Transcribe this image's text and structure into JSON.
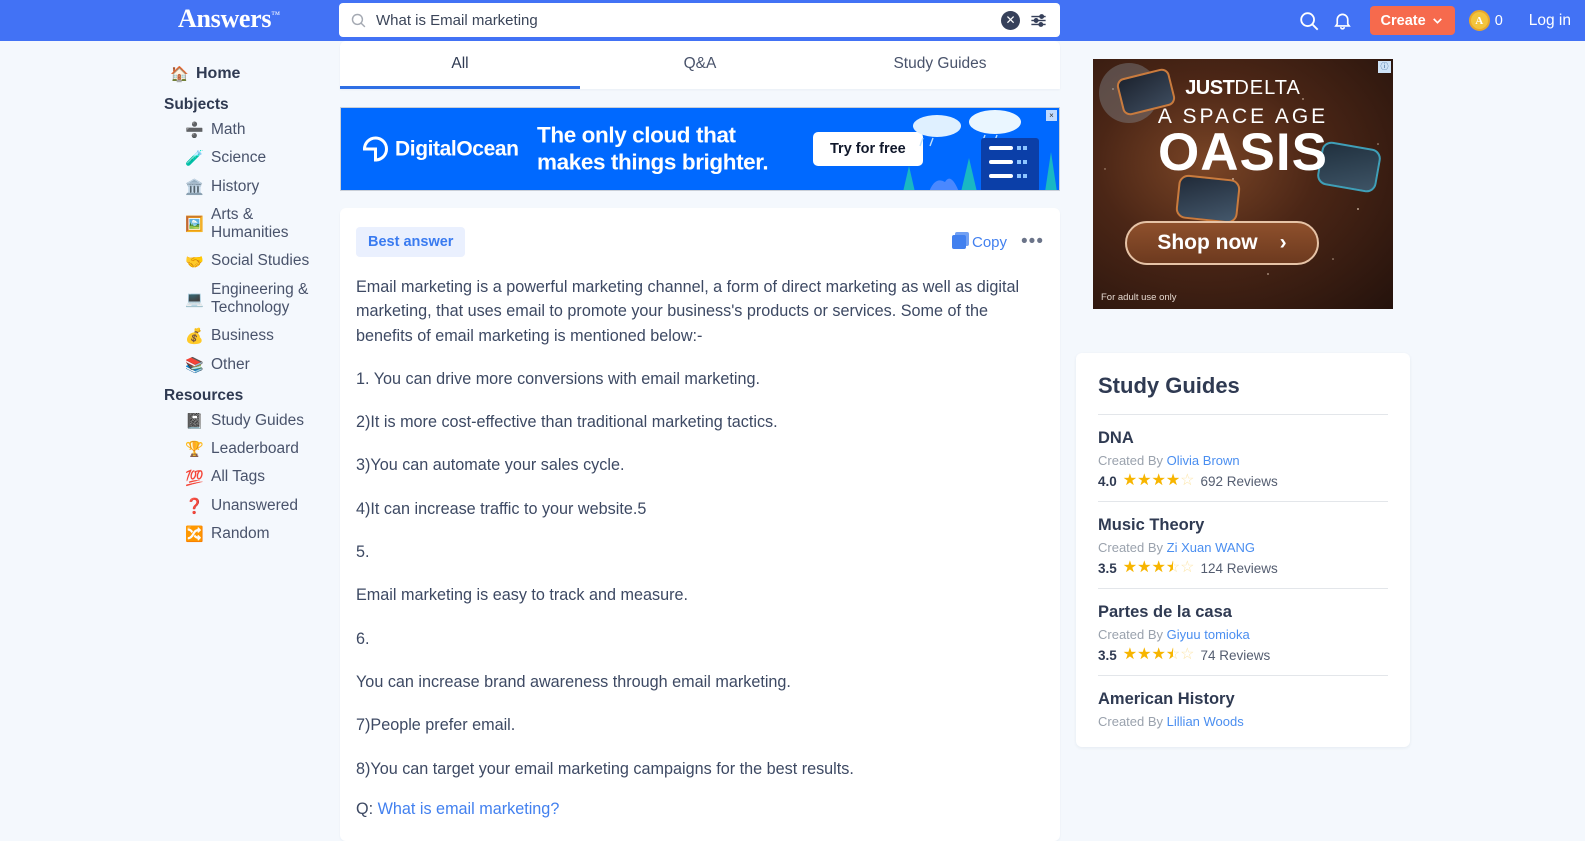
{
  "header": {
    "logo_text": "Answers",
    "logo_tm": "™",
    "search_value": "What is Email marketing",
    "search_placeholder": "Search",
    "clear_glyph": "✕",
    "create_label": "Create",
    "create_color": "#f66a4d",
    "coin_letter": "A",
    "coin_count": "0",
    "login_label": "Log in",
    "bar_color": "#4272f5"
  },
  "sidebar": {
    "home": {
      "emoji": "🏠",
      "label": "Home"
    },
    "subjects_heading": "Subjects",
    "subjects": [
      {
        "emoji": "➗",
        "label": "Math"
      },
      {
        "emoji": "🧪",
        "label": "Science"
      },
      {
        "emoji": "🏛️",
        "label": "History"
      },
      {
        "emoji": "🖼️",
        "label": "Arts & Humanities"
      },
      {
        "emoji": "🤝",
        "label": "Social Studies"
      },
      {
        "emoji": "💻",
        "label": "Engineering & Technology"
      },
      {
        "emoji": "💰",
        "label": "Business"
      },
      {
        "emoji": "📚",
        "label": "Other"
      }
    ],
    "resources_heading": "Resources",
    "resources": [
      {
        "emoji": "📓",
        "label": "Study Guides"
      },
      {
        "emoji": "🏆",
        "label": "Leaderboard"
      },
      {
        "emoji": "💯",
        "label": "All Tags"
      },
      {
        "emoji": "❓",
        "label": "Unanswered"
      },
      {
        "emoji": "🔀",
        "label": "Random"
      }
    ]
  },
  "main": {
    "tabs": [
      {
        "label": "All",
        "active": true
      },
      {
        "label": "Q&A",
        "active": false
      },
      {
        "label": "Study Guides",
        "active": false
      }
    ],
    "banner_ad": {
      "brand": "DigitalOcean",
      "line1": "The only cloud that",
      "line2": "makes things brighter.",
      "cta": "Try for free",
      "close_glyph": "×",
      "bg_color": "#0069ff"
    },
    "answer": {
      "badge": "Best answer",
      "copy_label": "Copy",
      "more_glyph": "•••",
      "paragraphs": [
        "Email marketing is a powerful marketing channel, a form of direct marketing as well as digital marketing, that uses email to promote your business's products or services. Some of the benefits of email marketing is mentioned below:-",
        "1. You can drive more conversions with email marketing.",
        "2)It is more cost-effective than traditional marketing tactics.",
        "3)You can automate your sales cycle.",
        "4)It can increase traffic to your website.5",
        "5.",
        "Email marketing is easy to track and measure.",
        "6.",
        "You can increase brand awareness through email marketing.",
        "7)People prefer email.",
        "8)You can target your email marketing campaigns for the best results."
      ],
      "question_prefix": "Q: ",
      "question_link": "What is email marketing?"
    }
  },
  "right": {
    "square_ad": {
      "brand_bold": "JUST",
      "brand_thin": "DELTA",
      "line1": "A SPACE AGE",
      "line2": "OASIS",
      "cta": "Shop now",
      "cta_arrow": "›",
      "legal": "For adult use only",
      "ad_mark": "ⓘ"
    },
    "study_guides": {
      "title": "Study Guides",
      "created_by_label": "Created By",
      "reviews_suffix": "Reviews",
      "items": [
        {
          "name": "DNA",
          "author": "Olivia Brown",
          "score": "4.0",
          "rating": 4.0,
          "reviews": "692"
        },
        {
          "name": "Music Theory",
          "author": "Zi Xuan WANG",
          "score": "3.5",
          "rating": 3.5,
          "reviews": "124"
        },
        {
          "name": "Partes de la casa",
          "author": "Giyuu tomioka",
          "score": "3.5",
          "rating": 3.5,
          "reviews": "74"
        },
        {
          "name": "American History",
          "author": "Lillian Woods",
          "score": "",
          "rating": 0,
          "reviews": ""
        }
      ]
    }
  }
}
